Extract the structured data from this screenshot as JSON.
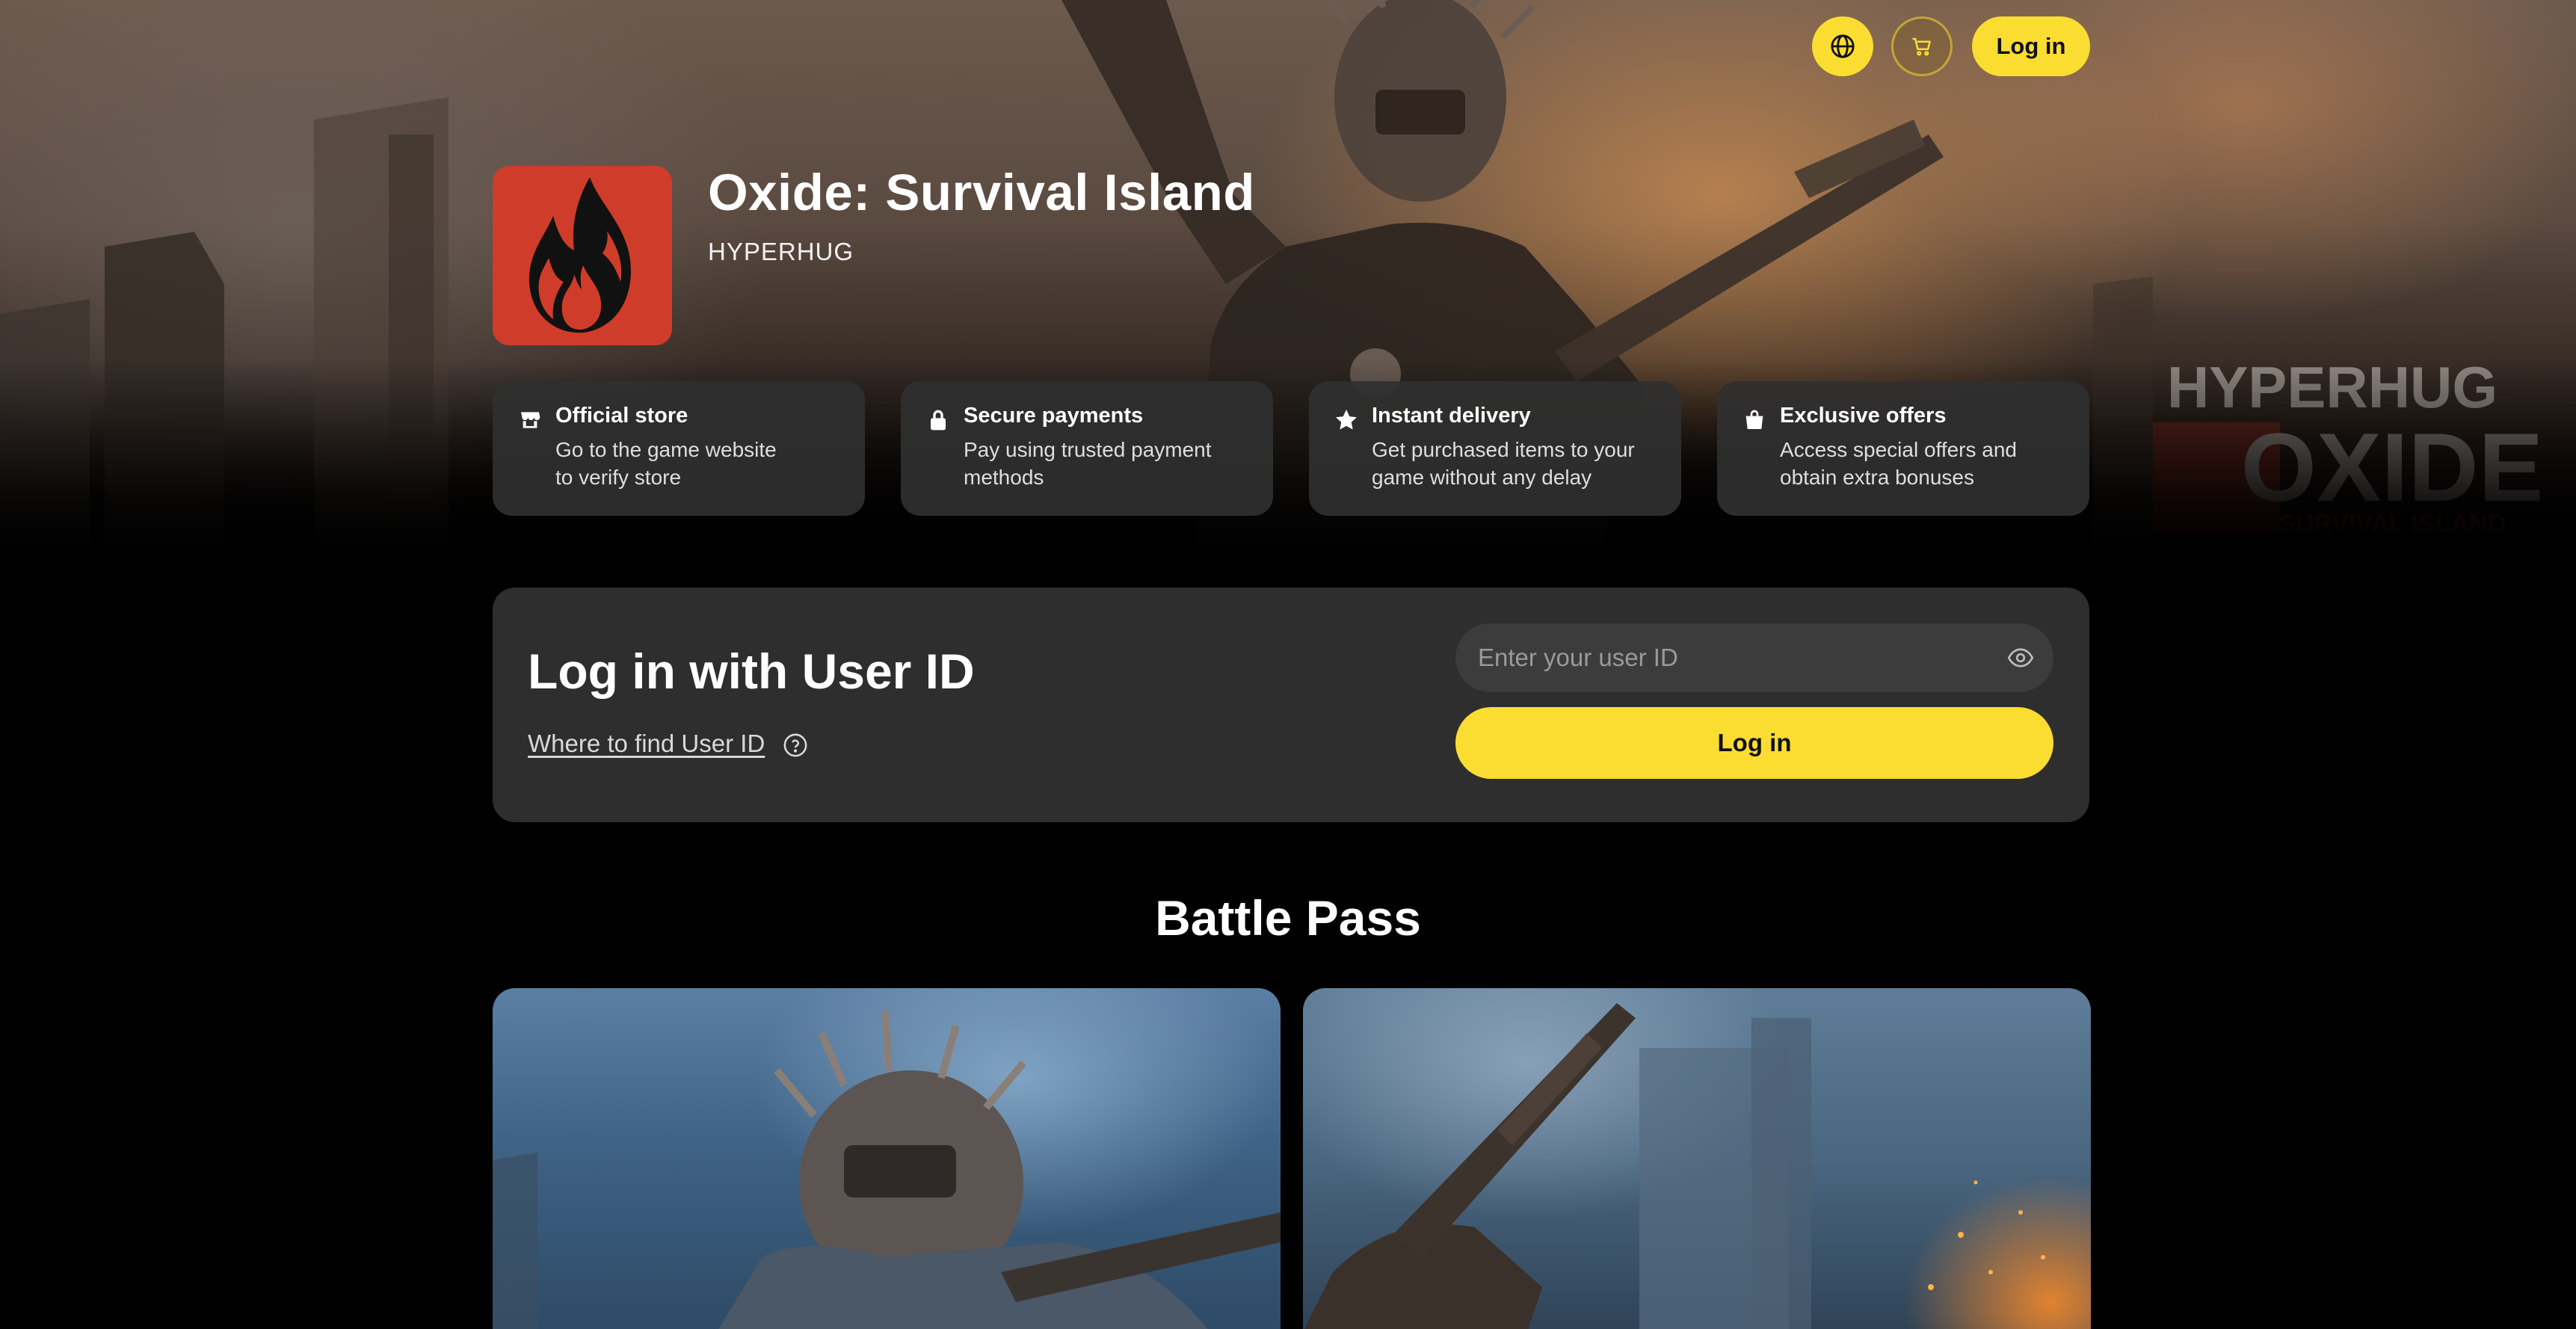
{
  "nav": {
    "globe_icon": "globe-icon",
    "cart_icon": "cart-icon",
    "login_label": "Log in"
  },
  "game": {
    "title": "Oxide: Survival Island",
    "publisher": "HYPERHUG",
    "icon": "flame-icon"
  },
  "features": [
    {
      "icon": "store-icon",
      "title": "Official store",
      "desc_line1": "Go to the game website",
      "desc_line2": "to verify store"
    },
    {
      "icon": "lock-icon",
      "title": "Secure payments",
      "desc_line1": "Pay using trusted payment",
      "desc_line2": "methods"
    },
    {
      "icon": "star-icon",
      "title": "Instant delivery",
      "desc_line1": "Get purchased items to your",
      "desc_line2": "game without any delay"
    },
    {
      "icon": "bag-icon",
      "title": "Exclusive offers",
      "desc_line1": "Access special offers and",
      "desc_line2": "obtain extra bonuses"
    }
  ],
  "login_panel": {
    "heading": "Log in with User ID",
    "find_link": "Where to find User ID",
    "input_placeholder": "Enter your user ID",
    "input_value": "",
    "button_label": "Log in"
  },
  "battle_pass": {
    "title": "Battle Pass"
  },
  "hero_watermark": {
    "brand": "HYPERHUG",
    "game": "OXIDE",
    "sub": "SURVIVAL ISLAND"
  },
  "colors": {
    "accent": "#fbdd32",
    "panel": "#2e2e2e",
    "card": "#303030",
    "icon_bg": "#cf3d2a",
    "background": "#000000"
  }
}
